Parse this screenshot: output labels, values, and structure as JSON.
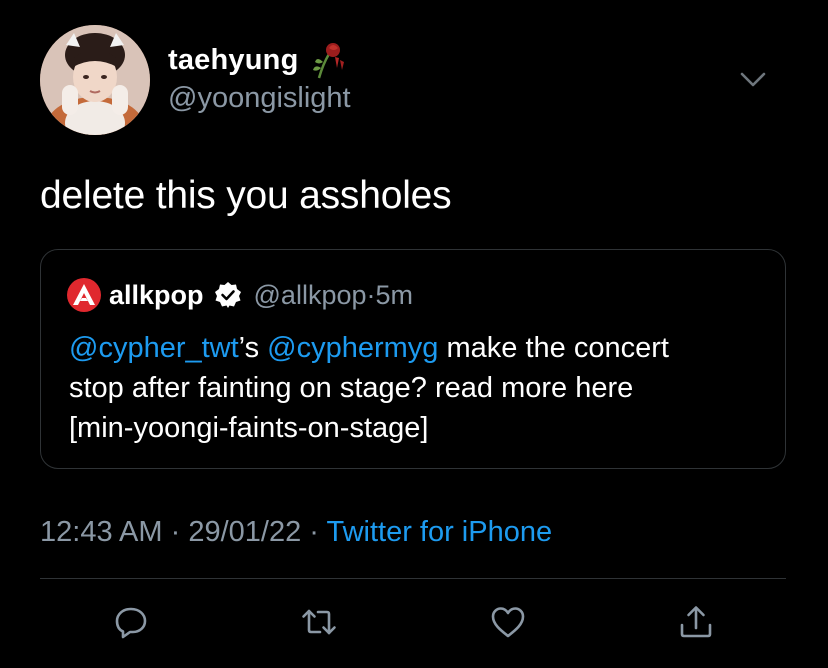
{
  "author": {
    "display_name": "taehyung",
    "handle": "@yoongislight"
  },
  "tweet": {
    "text": "delete this you assholes"
  },
  "quoted": {
    "name": "allkpop",
    "handle": "@allkpop",
    "separator": "·",
    "time": "5m",
    "mention1": "@cypher_twt",
    "possessive": "’s ",
    "mention2": "@cyphermyg",
    "text_line1_rest": " make the concert",
    "text_line2": "stop after fainting on stage? read more here",
    "text_line3": "[min-yoongi-faints-on-stage]"
  },
  "meta": {
    "time": "12:43 AM",
    "sep1": " · ",
    "date": "29/01/22",
    "sep2": " · ",
    "source": "Twitter for iPhone"
  },
  "colors": {
    "background": "#000000",
    "link": "#1d9bf0",
    "secondary_text": "#8b98a5",
    "border": "#2f3336"
  },
  "icons": [
    "flower-emoji-icon",
    "chevron-down-icon",
    "allkpop-logo-icon",
    "verified-badge-icon",
    "reply-icon",
    "retweet-icon",
    "like-icon",
    "share-icon"
  ]
}
